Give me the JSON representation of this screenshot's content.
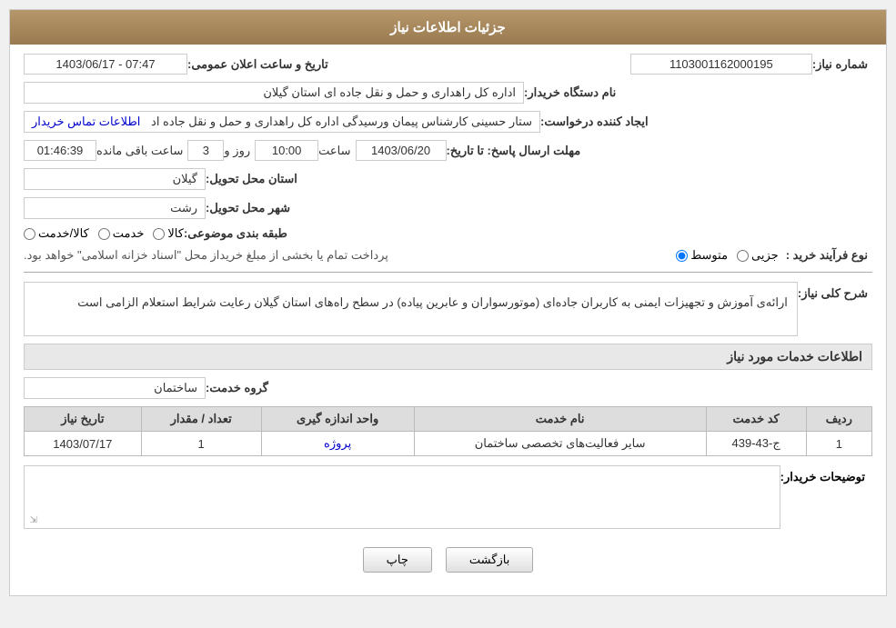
{
  "header": {
    "title": "جزئیات اطلاعات نیاز"
  },
  "fields": {
    "need_number_label": "شماره نیاز:",
    "need_number_value": "1103001162000195",
    "announcement_date_label": "تاریخ و ساعت اعلان عمومی:",
    "announcement_date_value": "1403/06/17 - 07:47",
    "requester_org_label": "نام دستگاه خریدار:",
    "requester_org_value": "اداره کل راهداری و حمل و نقل جاده ای استان گیلان",
    "creator_label": "ایجاد کننده درخواست:",
    "creator_value": "ستار حسینی کارشناس پیمان ورسیدگی اداره کل راهداری و حمل و نقل جاده اد",
    "creator_link": "اطلاعات تماس خریدار",
    "response_deadline_label": "مهلت ارسال پاسخ: تا تاریخ:",
    "response_date": "1403/06/20",
    "response_time_label": "ساعت",
    "response_time": "10:00",
    "response_days_label": "روز و",
    "response_days": "3",
    "remaining_label": "ساعت باقی مانده",
    "remaining_time": "01:46:39",
    "province_delivery_label": "استان محل تحویل:",
    "province_delivery_value": "گیلان",
    "city_delivery_label": "شهر محل تحویل:",
    "city_delivery_value": "رشت",
    "category_label": "طبقه بندی موضوعی:",
    "category_options": [
      {
        "label": "کالا",
        "checked": false
      },
      {
        "label": "خدمت",
        "checked": false
      },
      {
        "label": "کالا/خدمت",
        "checked": false
      }
    ],
    "purchase_type_label": "نوع فرآیند خرید :",
    "purchase_type_options": [
      {
        "label": "جزیی",
        "selected": false
      },
      {
        "label": "متوسط",
        "selected": true
      }
    ],
    "purchase_note": "پرداخت تمام یا بخشی از مبلغ خریداز محل \"اسناد خزانه اسلامی\" خواهد بود.",
    "need_description_label": "شرح کلی نیاز:",
    "need_description": "ارائه‌ی آموزش و تجهیزات ایمنی به کاربران جاده‌ای (موتورسواران و عابرین پیاده) در سطح راه‌های استان گیلان رعایت شرایط استعلام الزامی است",
    "services_title": "اطلاعات خدمات مورد نیاز",
    "service_group_label": "گروه خدمت:",
    "service_group_value": "ساختمان",
    "table": {
      "headers": [
        "ردیف",
        "کد خدمت",
        "نام خدمت",
        "واحد اندازه گیری",
        "تعداد / مقدار",
        "تاریخ نیاز"
      ],
      "rows": [
        {
          "row_num": "1",
          "service_code": "ج-43-439",
          "service_name": "سایر فعالیت‌های تخصصی ساختمان",
          "unit": "پروژه",
          "quantity": "1",
          "date": "1403/07/17"
        }
      ]
    },
    "buyer_notes_label": "توضیحات خریدار:"
  },
  "buttons": {
    "print": "چاپ",
    "back": "بازگشت"
  }
}
